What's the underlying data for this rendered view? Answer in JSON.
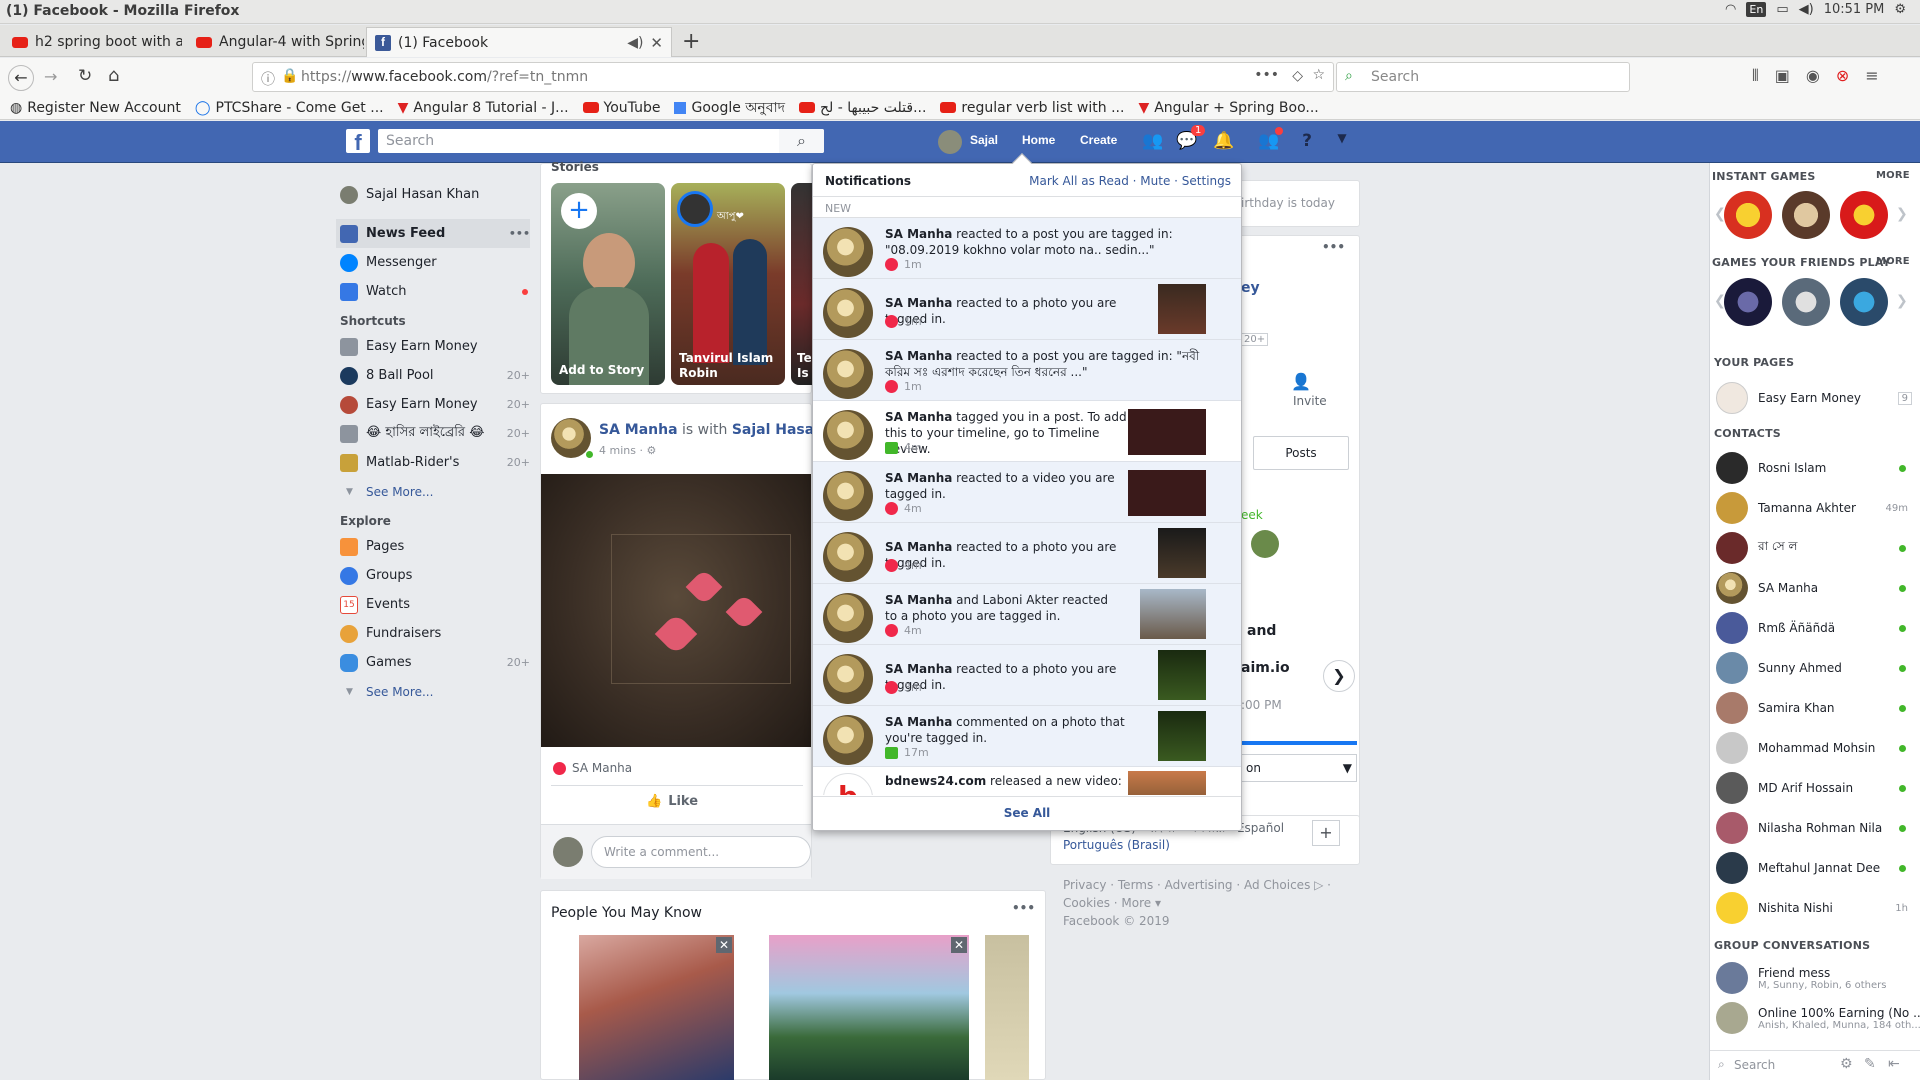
{
  "os": {
    "window_title": "(1) Facebook - Mozilla Firefox",
    "lang": "En",
    "clock": "10:51 PM"
  },
  "tabs": [
    {
      "label": "h2 spring boot with ang"
    },
    {
      "label": "Angular-4 with Spring b"
    },
    {
      "label": "(1) Facebook"
    }
  ],
  "url": {
    "value": "https://www.facebook.com/?ref=tn_tnmn",
    "host": "www.facebook.com",
    "prefix": "https://",
    "suffix": "/?ref=tn_tnmn"
  },
  "browser_search": {
    "placeholder": "Search"
  },
  "bookmarks": [
    {
      "label": "Register New Account"
    },
    {
      "label": "PTCShare - Come Get ..."
    },
    {
      "label": "Angular 8 Tutorial - J..."
    },
    {
      "label": "YouTube"
    },
    {
      "label": "Google অনুবাদ"
    },
    {
      "label": "قتلت حبيبها - لح..."
    },
    {
      "label": "regular verb list with ..."
    },
    {
      "label": "Angular + Spring Boo..."
    }
  ],
  "fb": {
    "search_placeholder": "Search",
    "user": "Sajal",
    "home": "Home",
    "create": "Create",
    "messenger_badge": "1"
  },
  "left_nav": {
    "profile": "Sajal Hasan Khan",
    "main": [
      {
        "label": "News Feed"
      },
      {
        "label": "Messenger"
      },
      {
        "label": "Watch"
      }
    ],
    "shortcuts_title": "Shortcuts",
    "shortcuts": [
      {
        "label": "Easy Earn Money",
        "count": ""
      },
      {
        "label": "8 Ball Pool",
        "count": "20+"
      },
      {
        "label": "Easy Earn Money",
        "count": "20+"
      },
      {
        "label": "😂 হাসির লাইব্রেরি 😂",
        "count": "20+"
      },
      {
        "label": "Matlab-Rider's",
        "count": "20+"
      }
    ],
    "see_more": "See More...",
    "explore_title": "Explore",
    "explore": [
      {
        "label": "Pages",
        "count": ""
      },
      {
        "label": "Groups",
        "count": ""
      },
      {
        "label": "Events",
        "count": ""
      },
      {
        "label": "Fundraisers",
        "count": ""
      },
      {
        "label": "Games",
        "count": "20+"
      }
    ]
  },
  "stories": {
    "title": "Stories",
    "items": [
      {
        "label": "Add to Story"
      },
      {
        "label": "Tanvirul Islam Robin"
      },
      {
        "label": "Te Is"
      }
    ],
    "tag": "আপু❤"
  },
  "post": {
    "author": "SA Manha",
    "with_text": "is with",
    "tagged": "Sajal Hasan Kh",
    "time": "4 mins · ⚙",
    "reaction_name": "SA Manha",
    "like": "Like",
    "comment_placeholder": "Write a comment..."
  },
  "pymk": {
    "title": "People You May Know"
  },
  "right_col": {
    "birthday_text": "irthday is today",
    "frag_ey": "ey",
    "frag_20": "20+",
    "invite": "Invite",
    "posts": "Posts",
    "frag_week": "eek",
    "frag_and": "and",
    "frag_aimio": "aim.io",
    "frag_pm": ":00 PM",
    "frag_on": "on",
    "languages": "English (US) · বাংলা · অসমীয়া · Español",
    "languages2": "Português (Brasil)",
    "footer1": "Privacy · Terms · Advertising · Ad Choices ▷ ·",
    "footer2": "Cookies · More ▾",
    "footer3": "Facebook © 2019"
  },
  "notifications": {
    "title": "Notifications",
    "mark_all": "Mark All as Read",
    "mute": "Mute",
    "settings": "Settings",
    "section": "NEW",
    "see_all": "See All",
    "items": [
      {
        "actor": "SA Manha",
        "text": " reacted to a post you are tagged in: \"08.09.2019 kokhno volar moto na.. sedin...\"",
        "time": "1m",
        "kind": "heart"
      },
      {
        "actor": "SA Manha",
        "text": " reacted to a photo you are tagged in.",
        "time": "1m",
        "kind": "heart"
      },
      {
        "actor": "SA Manha",
        "text": " reacted to a post you are tagged in: \"নবী করিম সঃ এরশাদ করেছেন তিন ধরনের ...\"",
        "time": "1m",
        "kind": "heart"
      },
      {
        "actor": "SA Manha",
        "text": " tagged you in a post. To add this to your timeline, go to Timeline Review.",
        "time": "4m",
        "kind": "comment"
      },
      {
        "actor": "SA Manha",
        "text": " reacted to a video you are tagged in.",
        "time": "4m",
        "kind": "heart"
      },
      {
        "actor": "SA Manha",
        "text": " reacted to a photo you are tagged in.",
        "time": "4m",
        "kind": "heart"
      },
      {
        "actor": "SA Manha",
        "text": " and Laboni Akter reacted to a photo you are tagged in.",
        "time": "4m",
        "kind": "heart"
      },
      {
        "actor": "SA Manha",
        "text": " reacted to a photo you are tagged in.",
        "time": "3m",
        "kind": "heart"
      },
      {
        "actor": "SA Manha",
        "text": " commented on a photo that you're tagged in.",
        "time": "17m",
        "kind": "comment"
      },
      {
        "actor": "bdnews24.com",
        "text": " released a new video:",
        "time": "",
        "kind": "none"
      }
    ]
  },
  "sidebar": {
    "instant_games": "INSTANT GAMES",
    "more": "MORE",
    "friends_play": "GAMES YOUR FRIENDS PLAY",
    "your_pages": "YOUR PAGES",
    "page_name": "Easy Earn Money",
    "page_badge": "9",
    "contacts_title": "CONTACTS",
    "contacts": [
      {
        "name": "Rosni Islam",
        "status": ""
      },
      {
        "name": "Tamanna Akhter",
        "status": "49m"
      },
      {
        "name": "রা সে ল",
        "status": ""
      },
      {
        "name": "SA Manha",
        "status": ""
      },
      {
        "name": "Rmß Äñäñdä",
        "status": ""
      },
      {
        "name": "Sunny Ahmed",
        "status": ""
      },
      {
        "name": "Samira Khan",
        "status": ""
      },
      {
        "name": "Mohammad Mohsin",
        "status": ""
      },
      {
        "name": "MD Arif Hossain",
        "status": ""
      },
      {
        "name": "Nilasha Rohman Nila",
        "status": ""
      },
      {
        "name": "Meftahul Jannat Dee",
        "status": ""
      },
      {
        "name": "Nishita Nishi",
        "status": "1h"
      }
    ],
    "group_title": "GROUP CONVERSATIONS",
    "groups": [
      {
        "name": "Friend mess",
        "members": "M, Sunny, Robin, 6 others"
      },
      {
        "name": "Online 100% Earning (No ...",
        "members": "Anish, Khaled, Munna, 184 oth..."
      }
    ],
    "search_placeholder": "Search"
  },
  "colors": {
    "fb_blue": "#4267b2",
    "link": "#365899",
    "notif_bg": "#edf2fa",
    "online": "#42b72a",
    "heart": "#f0284a"
  }
}
